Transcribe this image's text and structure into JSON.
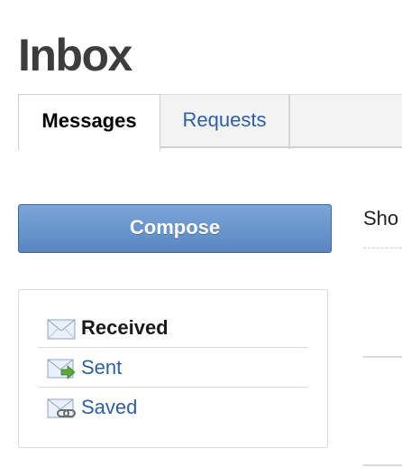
{
  "page": {
    "title": "Inbox"
  },
  "tabs": [
    {
      "label": "Messages",
      "active": true
    },
    {
      "label": "Requests",
      "active": false
    }
  ],
  "compose": {
    "label": "Compose"
  },
  "folders": [
    {
      "label": "Received",
      "icon": "envelope-icon",
      "active": true
    },
    {
      "label": "Sent",
      "icon": "envelope-sent-icon",
      "active": false
    },
    {
      "label": "Saved",
      "icon": "envelope-saved-icon",
      "active": false
    }
  ],
  "filter": {
    "label": "Sho"
  },
  "colors": {
    "link": "#2d5fa8",
    "compose_gradient_top": "#7aa6da",
    "compose_gradient_bottom": "#5a86c1",
    "title": "#3d3d3d"
  }
}
